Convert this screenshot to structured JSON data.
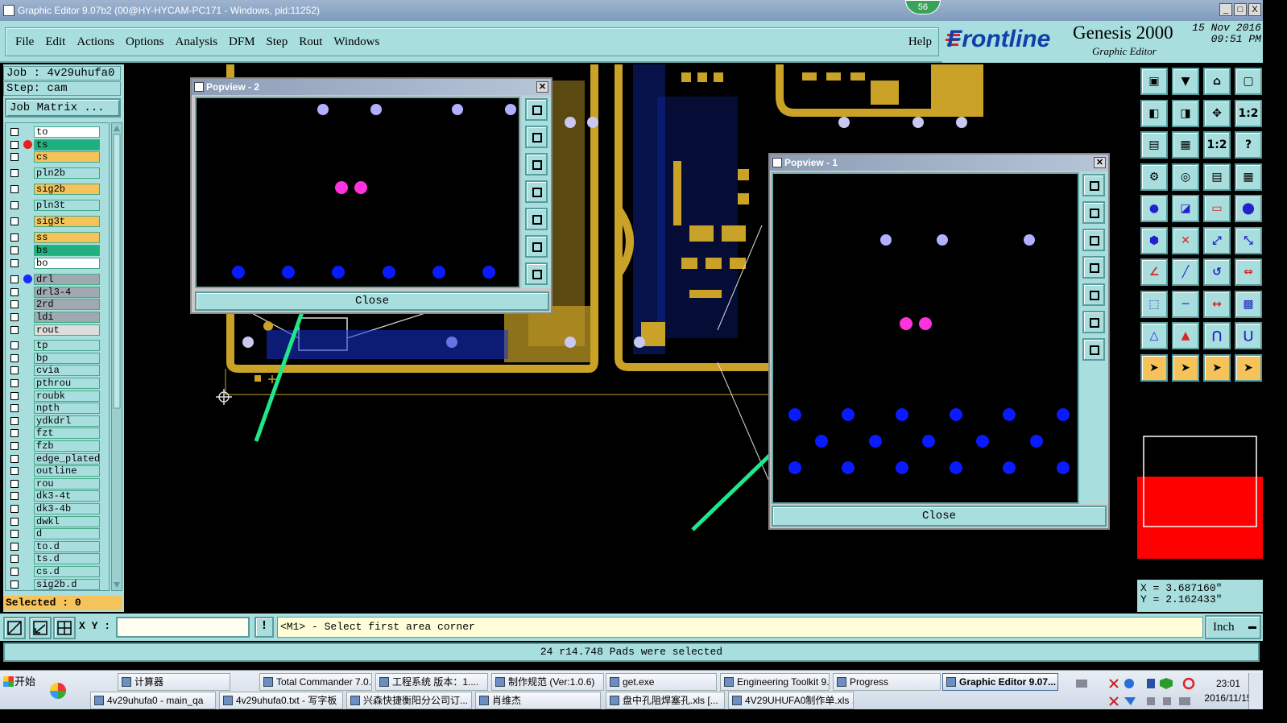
{
  "window": {
    "title": "Graphic Editor 9.07b2 (00@HY-HYCAM-PC171 - Windows, pid:11252)",
    "badge": "56",
    "controls": [
      "_",
      "□",
      "X"
    ]
  },
  "menu": {
    "items": [
      "File",
      "Edit",
      "Actions",
      "Options",
      "Analysis",
      "DFM",
      "Step",
      "Rout",
      "Windows"
    ],
    "help": "Help"
  },
  "brand": {
    "logo": "Frontline",
    "product": "Genesis 2000",
    "subtitle": "Graphic Editor",
    "date": "15 Nov 2016",
    "time": "09:51 PM"
  },
  "job": {
    "job_label": "Job : 4v29uhufa0",
    "step_label": "Step: cam",
    "matrix_button": "Job Matrix ..."
  },
  "layers": [
    {
      "name": "to",
      "color": "#ffffff",
      "marker": ""
    },
    {
      "name": "ts",
      "color": "#20b080",
      "marker": "red"
    },
    {
      "name": "cs",
      "color": "#f6c35a",
      "marker": ""
    },
    {
      "name": "pln2b",
      "color": "#a8dede",
      "marker": ""
    },
    {
      "name": "sig2b",
      "color": "#f6c35a",
      "marker": ""
    },
    {
      "name": "pln3t",
      "color": "#a8dede",
      "marker": ""
    },
    {
      "name": "sig3t",
      "color": "#f6c35a",
      "marker": ""
    },
    {
      "name": "ss",
      "color": "#f6c35a",
      "marker": ""
    },
    {
      "name": "bs",
      "color": "#20b080",
      "marker": ""
    },
    {
      "name": "bo",
      "color": "#ffffff",
      "marker": ""
    },
    {
      "name": "drl",
      "color": "#a0a8b0",
      "marker": "blue"
    },
    {
      "name": "drl3-4",
      "color": "#a0a8b0",
      "marker": ""
    },
    {
      "name": "2rd",
      "color": "#a0a8b0",
      "marker": ""
    },
    {
      "name": "ldi",
      "color": "#a0a8b0",
      "marker": ""
    },
    {
      "name": "rout",
      "color": "#dddddd",
      "marker": ""
    },
    {
      "name": "tp",
      "color": "#a8dede",
      "marker": ""
    },
    {
      "name": "bp",
      "color": "#a8dede",
      "marker": ""
    },
    {
      "name": "cvia",
      "color": "#a8dede",
      "marker": ""
    },
    {
      "name": "pthrou",
      "color": "#a8dede",
      "marker": ""
    },
    {
      "name": "roubk",
      "color": "#a8dede",
      "marker": ""
    },
    {
      "name": "npth",
      "color": "#a8dede",
      "marker": ""
    },
    {
      "name": "ydkdrl",
      "color": "#a8dede",
      "marker": ""
    },
    {
      "name": "fzt",
      "color": "#a8dede",
      "marker": ""
    },
    {
      "name": "fzb",
      "color": "#a8dede",
      "marker": ""
    },
    {
      "name": "edge_plated",
      "color": "#a8dede",
      "marker": ""
    },
    {
      "name": "outline",
      "color": "#a8dede",
      "marker": ""
    },
    {
      "name": "rou",
      "color": "#a8dede",
      "marker": ""
    },
    {
      "name": "dk3-4t",
      "color": "#a8dede",
      "marker": ""
    },
    {
      "name": "dk3-4b",
      "color": "#a8dede",
      "marker": ""
    },
    {
      "name": "dwkl",
      "color": "#a8dede",
      "marker": ""
    },
    {
      "name": "d",
      "color": "#a8dede",
      "marker": ""
    },
    {
      "name": "to.d",
      "color": "#a8dede",
      "marker": ""
    },
    {
      "name": "ts.d",
      "color": "#a8dede",
      "marker": ""
    },
    {
      "name": "cs.d",
      "color": "#a8dede",
      "marker": ""
    },
    {
      "name": "sig2b.d",
      "color": "#a8dede",
      "marker": ""
    }
  ],
  "selected_label": "Selected : 0",
  "popview2": {
    "title": "Popview - 2",
    "close": "Close"
  },
  "popview1": {
    "title": "Popview - 1",
    "close": "Close"
  },
  "coords": {
    "x": "X = 3.687160\"",
    "y": "Y = 2.162433\""
  },
  "command": {
    "xy_label": "X Y :",
    "xy_value": "",
    "excl": "!",
    "prompt": "<M1> - Select first area corner",
    "units": "Inch"
  },
  "status": "24 r14.748 Pads were selected",
  "colors": {
    "panel": "#a8dede",
    "copper": "#c9a227",
    "pad_selected": "#ff33dd",
    "pad": "#0a1aff",
    "pad_light": "#b0b0ff",
    "arrow": "#1ee888"
  },
  "taskbar": {
    "start": "开始",
    "row1": [
      "计算器",
      "Total Commander 7.0...",
      "工程系统  版本：1....",
      "制作规范 (Ver:1.0.6)",
      "get.exe",
      "Engineering Toolkit 9....",
      "Progress",
      "Graphic Editor 9.07..."
    ],
    "row2": [
      "4v29uhufa0 - main_qa",
      "4v29uhufa0.txt - 写字板",
      "兴森快捷衡阳分公司订...",
      "肖维杰",
      "盘中孔阻焊塞孔.xls  [...",
      "4V29UHUFA0制作单.xls ..."
    ],
    "time": "23:01",
    "date": "2016/11/15"
  }
}
